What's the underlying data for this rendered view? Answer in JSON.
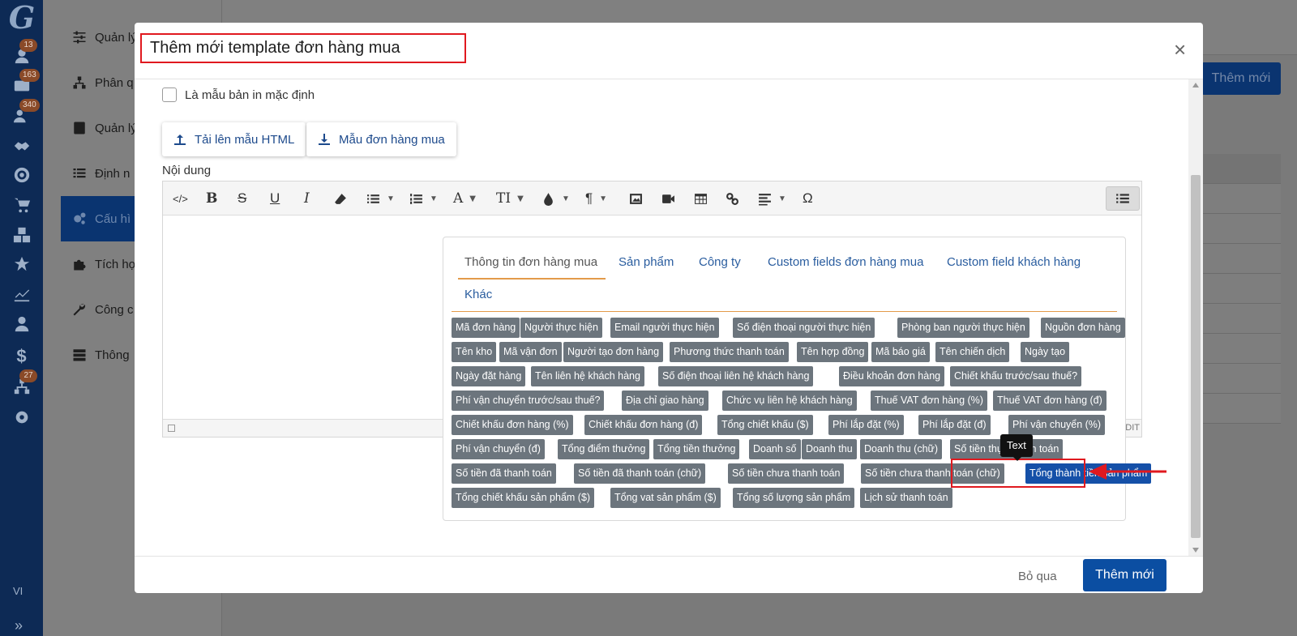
{
  "sidebar_rail": {
    "logo": "G",
    "badges": [
      "13",
      "163",
      "340",
      "27"
    ],
    "icons": [
      "user-icon",
      "mail-icon",
      "users-icon",
      "handshake-icon",
      "target-icon",
      "cart-icon",
      "boxes-icon",
      "star-icon",
      "chart-line-icon",
      "person-icon",
      "dollar-icon",
      "sitemap-icon",
      "gear-icon"
    ],
    "language": "VI",
    "expand": "»"
  },
  "submenu": {
    "items": [
      {
        "label": "Quản lý",
        "icon": "sliders-icon"
      },
      {
        "label": "Phân q",
        "icon": "sitemap-icon"
      },
      {
        "label": "Quản lý",
        "icon": "contact-card-icon"
      },
      {
        "label": "Định n",
        "icon": "list-icon"
      },
      {
        "label": "Cấu hì",
        "icon": "cogs-icon"
      },
      {
        "label": "Tích hợ",
        "icon": "puzzle-icon"
      },
      {
        "label": "Công c",
        "icon": "wrench-icon"
      },
      {
        "label": "Thông",
        "icon": "server-icon"
      }
    ]
  },
  "background": {
    "add_button": "Thêm mới"
  },
  "modal": {
    "title": "Thêm mới template đơn hàng mua",
    "close": "×",
    "default_print_label": "Là mẫu bản in mặc định",
    "upload_html_label": "Tải lên mẫu HTML",
    "sample_label": "Mẫu đơn hàng mua",
    "content_label": "Nội dung",
    "editor_status_text": "DIT",
    "toolbar_icons": [
      "code-view-icon",
      "bold-icon",
      "strikethrough-icon",
      "underline-icon",
      "italic-icon",
      "eraser-icon",
      "bullet-list-icon",
      "numbered-list-icon",
      "font-color-icon",
      "font-size-icon",
      "ink-drop-icon",
      "paragraph-icon",
      "image-icon",
      "video-icon",
      "table-icon",
      "link-icon",
      "align-icon",
      "omega-icon",
      "variable-list-icon"
    ],
    "toolbar_glyphs": {
      "bold": "B",
      "strike": "S",
      "underline": "U",
      "italic": "I",
      "font": "A",
      "fontsize": "TI",
      "paragraph": "¶",
      "omega": "Ω"
    },
    "tabs": [
      "Thông tin đơn hàng mua",
      "Sản phẩm",
      "Công ty",
      "Custom fields đơn hàng mua",
      "Custom field khách hàng",
      "Khác"
    ],
    "active_tab": 0,
    "chips": [
      [
        "Mã đơn hàng",
        "Người thực hiện",
        "Email người thực hiện",
        "Số điện thoại người thực hiện",
        "Phòng ban người thực hiện",
        "Nguồn đơn hàng"
      ],
      [
        "Tên kho",
        "Mã vận đơn",
        "Người tạo đơn hàng",
        "Phương thức thanh toán",
        "Tên hợp đồng",
        "Mã báo giá",
        "Tên chiến dịch",
        "Ngày tạo"
      ],
      [
        "Ngày đặt hàng",
        "Tên liên hệ khách hàng",
        "Số điện thoại liên hệ khách hàng",
        "Điều khoản đơn hàng",
        "Chiết khấu trước/sau thuế?"
      ],
      [
        "Phí vận chuyển trước/sau thuế?",
        "Địa chỉ giao hàng",
        "Chức vụ liên hệ khách hàng",
        "Thuế VAT đơn hàng (%)",
        "Thuế VAT đơn hàng (đ)"
      ],
      [
        "Chiết khấu đơn hàng (%)",
        "Chiết khấu đơn hàng (đ)",
        "Tổng chiết khấu ($)",
        "Phí lắp đặt (%)",
        "Phí lắp đặt (đ)",
        "Phí vận chuyển (%)"
      ],
      [
        "Phí vận chuyển (đ)",
        "Tổng điểm thưởng",
        "Tổng tiền thưởng",
        "Doanh số",
        "Doanh thu",
        "Doanh thu (chữ)",
        "Số tiền thực tế c h toán"
      ],
      [
        "Số tiền đã thanh toán",
        "Số tiền đã thanh toán (chữ)",
        "Số tiền chưa thanh toán",
        "Số tiền chưa thanh toán (chữ)",
        "Tổng thành tiền sản phẩm"
      ],
      [
        "Tổng chiết khấu sản phẩm ($)",
        "Tổng vat sản phẩm ($)",
        "Tổng số lượng sản phẩm",
        "Lịch sử thanh toán"
      ]
    ],
    "selected_chip": "Tổng thành tiền sản phẩm",
    "tooltip": "Text",
    "skip_label": "Bỏ qua",
    "submit_label": "Thêm mới",
    "colors": {
      "primary": "#0b4ea2",
      "chip": "#6c757d",
      "highlight": "#e0191f",
      "tab_underline": "#e39a4a"
    }
  }
}
